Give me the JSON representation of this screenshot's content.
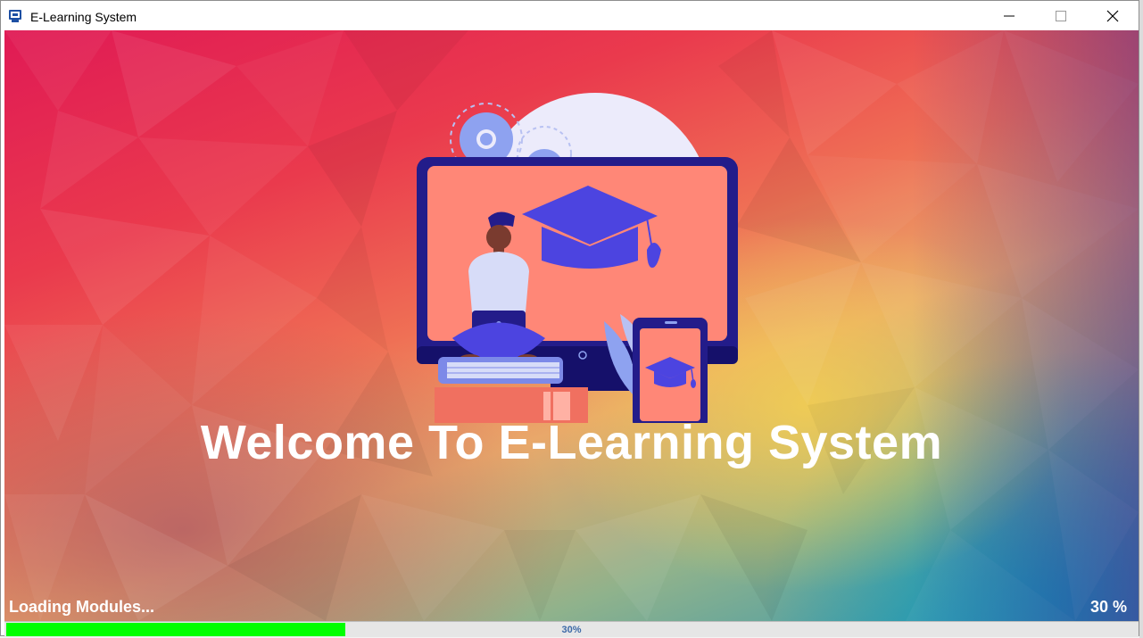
{
  "window": {
    "title": "E-Learning System",
    "controls": {
      "minimize": "minimize",
      "maximize": "maximize",
      "close": "close"
    }
  },
  "splash": {
    "welcome": "Welcome To E-Learning System",
    "status": "Loading Modules...",
    "percent_label": "30 %"
  },
  "progress": {
    "value": 0.3,
    "label": "30%",
    "fill_color": "#00ff00",
    "text_color": "#3d6aa8"
  },
  "icons": [
    "app-icon",
    "minimize-icon",
    "maximize-icon",
    "close-icon",
    "graduation-cap-icon",
    "gear-icon",
    "tablet-icon",
    "books-icon"
  ]
}
